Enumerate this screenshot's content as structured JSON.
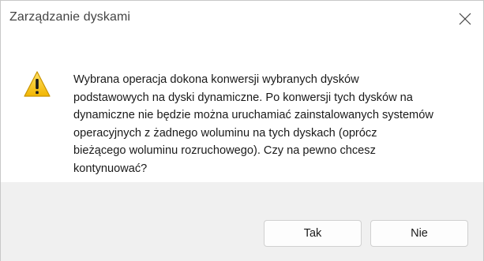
{
  "window": {
    "title": "Zarządzanie dyskami",
    "close_icon": "close-icon"
  },
  "dialog": {
    "icon": "warning-icon",
    "message": "Wybrana operacja dokona konwersji wybranych dysków podstawowych na dyski dynamiczne. Po konwersji tych dysków na dynamiczne nie będzie można uruchamiać zainstalowanych systemów operacyjnych z żadnego woluminu na tych dyskach (oprócz bieżącego woluminu rozruchowego). Czy na pewno chcesz kontynuować?",
    "message_lines": [
      "Wybrana operacja dokona konwersji wybranych dysków",
      "podstawowych na dyski dynamiczne. Po konwersji tych dysków na",
      "dynamiczne nie będzie można uruchamiać zainstalowanych systemów",
      "operacyjnych z żadnego woluminu na tych dyskach (oprócz",
      "bieżącego woluminu rozruchowego). Czy na pewno chcesz",
      "kontynuować?"
    ]
  },
  "buttons": {
    "yes_label": "Tak",
    "no_label": "Nie"
  },
  "colors": {
    "footer_background": "#f0f0f0",
    "warning_yellow": "#f5c518",
    "text": "#1a1a1a"
  }
}
